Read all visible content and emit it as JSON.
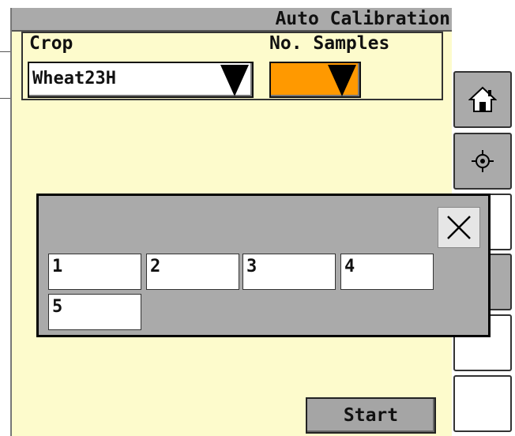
{
  "header": {
    "title": "Auto Calibration"
  },
  "crop": {
    "label": "Crop",
    "selected": "Wheat23H"
  },
  "samples": {
    "label": "No. Samples",
    "selected": "",
    "accent": "#ff9900"
  },
  "side_buttons": [
    {
      "icon": "home-icon"
    },
    {
      "icon": "target-icon"
    },
    {
      "icon": ""
    },
    {
      "icon": ""
    },
    {
      "icon": ""
    },
    {
      "icon": ""
    }
  ],
  "popup": {
    "options": [
      "1",
      "2",
      "3",
      "4",
      "5"
    ],
    "close_icon": "close-icon"
  },
  "footer": {
    "start_label": "Start"
  },
  "colors": {
    "background": "#fdfbcc",
    "panel_gray": "#aaaaaa",
    "accent_orange": "#ff9900"
  }
}
